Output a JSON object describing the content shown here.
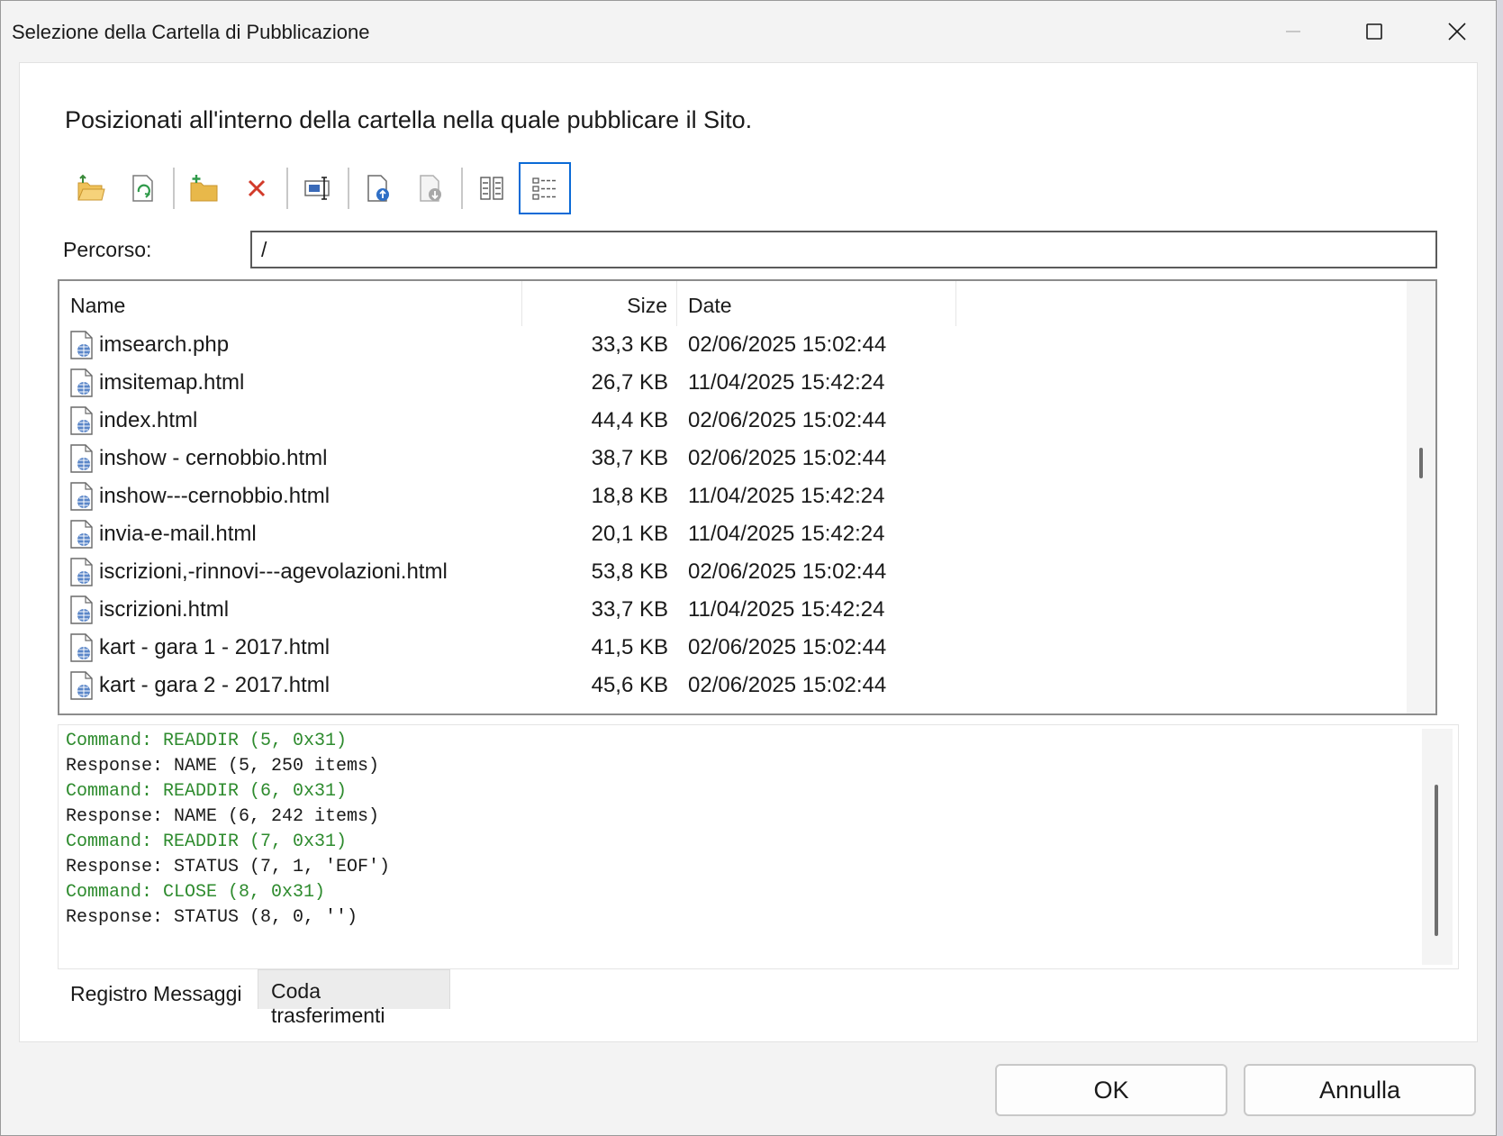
{
  "window": {
    "title": "Selezione della Cartella di Pubblicazione"
  },
  "instruction": "Posizionati all'interno della cartella nella quale pubblicare il Sito.",
  "toolbar": {
    "buttons": [
      {
        "icon": "open-folder-icon"
      },
      {
        "icon": "refresh-icon"
      },
      {
        "icon": "new-folder-icon"
      },
      {
        "icon": "delete-icon"
      },
      {
        "icon": "rename-icon"
      },
      {
        "icon": "upload-icon"
      },
      {
        "icon": "download-icon"
      },
      {
        "icon": "columns-view-icon"
      },
      {
        "icon": "details-view-icon",
        "active": true
      }
    ]
  },
  "path": {
    "label": "Percorso:",
    "value": "/"
  },
  "filelist": {
    "columns": [
      "Name",
      "Size",
      "Date"
    ],
    "rows": [
      {
        "name": "imsearch.php",
        "size": "33,3 KB",
        "date": "02/06/2025 15:02:44"
      },
      {
        "name": "imsitemap.html",
        "size": "26,7 KB",
        "date": "11/04/2025 15:42:24"
      },
      {
        "name": "index.html",
        "size": "44,4 KB",
        "date": "02/06/2025 15:02:44"
      },
      {
        "name": "inshow - cernobbio.html",
        "size": "38,7 KB",
        "date": "02/06/2025 15:02:44"
      },
      {
        "name": "inshow---cernobbio.html",
        "size": "18,8 KB",
        "date": "11/04/2025 15:42:24"
      },
      {
        "name": "invia-e-mail.html",
        "size": "20,1 KB",
        "date": "11/04/2025 15:42:24"
      },
      {
        "name": "iscrizioni,-rinnovi---agevolazioni.html",
        "size": "53,8 KB",
        "date": "02/06/2025 15:02:44"
      },
      {
        "name": "iscrizioni.html",
        "size": "33,7 KB",
        "date": "11/04/2025 15:42:24"
      },
      {
        "name": "kart - gara 1 - 2017.html",
        "size": "41,5 KB",
        "date": "02/06/2025 15:02:44"
      },
      {
        "name": "kart - gara 2 - 2017.html",
        "size": "45,6 KB",
        "date": "02/06/2025 15:02:44"
      }
    ]
  },
  "log": {
    "lines": [
      {
        "type": "cmd",
        "text": "Command: READDIR (5, 0x31)"
      },
      {
        "type": "resp",
        "text": "Response: NAME (5, 250 items)"
      },
      {
        "type": "cmd",
        "text": "Command: READDIR (6, 0x31)"
      },
      {
        "type": "resp",
        "text": "Response: NAME (6, 242 items)"
      },
      {
        "type": "cmd",
        "text": "Command: READDIR (7, 0x31)"
      },
      {
        "type": "resp",
        "text": "Response: STATUS (7, 1, 'EOF')"
      },
      {
        "type": "cmd",
        "text": "Command: CLOSE (8, 0x31)"
      },
      {
        "type": "resp",
        "text": "Response: STATUS (8, 0, '')"
      }
    ],
    "colors": {
      "cmd": "#2e8b2e",
      "resp": "#1a1a1a"
    }
  },
  "tabs": {
    "messages": "Registro Messaggi",
    "queue": "Coda trasferimenti"
  },
  "buttons": {
    "ok": "OK",
    "cancel": "Annulla"
  },
  "colors": {
    "accent": "#0a6ad6",
    "file_icon": "#3a6ab8",
    "folder": "#e8b84a",
    "delete": "#d23a2a"
  }
}
